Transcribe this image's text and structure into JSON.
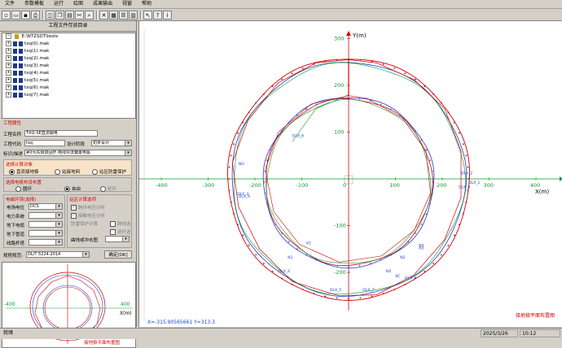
{
  "menu": [
    "文件",
    "参数模板",
    "运行",
    "绘图",
    "成果输出",
    "视窗",
    "帮助"
  ],
  "toolbar_icons": [
    "new-file-icon",
    "open-file-icon",
    "save-icon",
    "print-icon",
    "preview-icon",
    "copy-icon",
    "paste-icon",
    "cut-icon",
    "find-icon",
    "delete-icon",
    "grid-icon",
    "list-icon",
    "chart-icon",
    "pointer-icon",
    "help-icon",
    "info-icon"
  ],
  "left": {
    "title": "工程文件存放目录",
    "tree_root": "E:\\NTZSDT\\tests",
    "tree_files": [
      "txq(0).mak",
      "txq(1).mak",
      "txq(2).mak",
      "txq(3).mak",
      "txq(4).mak",
      "txq(5).mak",
      "txq(6).mak",
      "txq(7).mak"
    ],
    "project": {
      "header": "工程属性",
      "name_label": "工程名称",
      "name_value": "TXQ-SE直流输电",
      "code_label": "工程代码",
      "code_value": "txq",
      "stage_label": "设计阶段",
      "stage_value": "初步设计",
      "desc_label": "标识/描述",
      "desc_value": "#0为东侧双回杆,电线导流偏置电极",
      "select_obj_title": "选择计算对象",
      "obj_options": [
        "直流接地极",
        "站接地网",
        "站区防雷保护"
      ],
      "layout_title": "选择电极布设布置",
      "layout_options": [
        "圆环",
        "自由",
        "矩环"
      ],
      "env_title": "电磁环境(选择)",
      "env_rows": [
        {
          "label": "电场电位",
          "value": "DCS"
        },
        {
          "label": "电力系统",
          "value": ""
        },
        {
          "label": "地下电缆",
          "value": ""
        },
        {
          "label": "地下管道",
          "value": ""
        },
        {
          "label": "线路杆塔",
          "value": ""
        }
      ],
      "station_title": "站区计算选项",
      "station_opts": [
        "跨步电压分析",
        "接触电压分析",
        "防雷保护计算"
      ],
      "station_side": [
        "跨线选",
        "逐杆选"
      ],
      "curve_label": "曲线或冲击图",
      "std_label": "规程规范:",
      "std_value": "DL/T 5224-2014",
      "confirm_label": "确定[OK]"
    },
    "preview_caption": "接地极平面布置图",
    "preview_ticks": [
      "-400",
      "400"
    ],
    "preview_axis": "X(m)"
  },
  "canvas": {
    "x_axis_label": "X(m)",
    "y_axis_label": "Y(m)",
    "x_ticks": [
      "-400",
      "-300",
      "-200",
      "-100",
      "0",
      "100",
      "200",
      "300",
      "400"
    ],
    "y_ticks": [
      "300",
      "200",
      "100",
      "-100",
      "-200"
    ],
    "caption": "接地极平面布置图",
    "coord_readout": "X=-315.90565661   Y=313.3",
    "point_labels": [
      "DLX_1",
      "DLX_2",
      "DLX_3",
      "DLX_4",
      "DLX_5",
      "DLX_6",
      "DLX_7",
      "DLX_8",
      "DLX_9",
      "DLX_0",
      "NO",
      "N1",
      "N2",
      "N3",
      "KO",
      "KC",
      "K1",
      "N0"
    ],
    "colors": {
      "outer_ring": "#d40000",
      "inner_ring": "#1a3fd0",
      "ring_green": "#0a9a2a",
      "axis": "#d40000",
      "grid_axis": "#0a9a2a",
      "label": "#1a3fd0"
    }
  },
  "status": {
    "ready": "就绪",
    "date": "2025/3/26",
    "time": "10:12"
  }
}
